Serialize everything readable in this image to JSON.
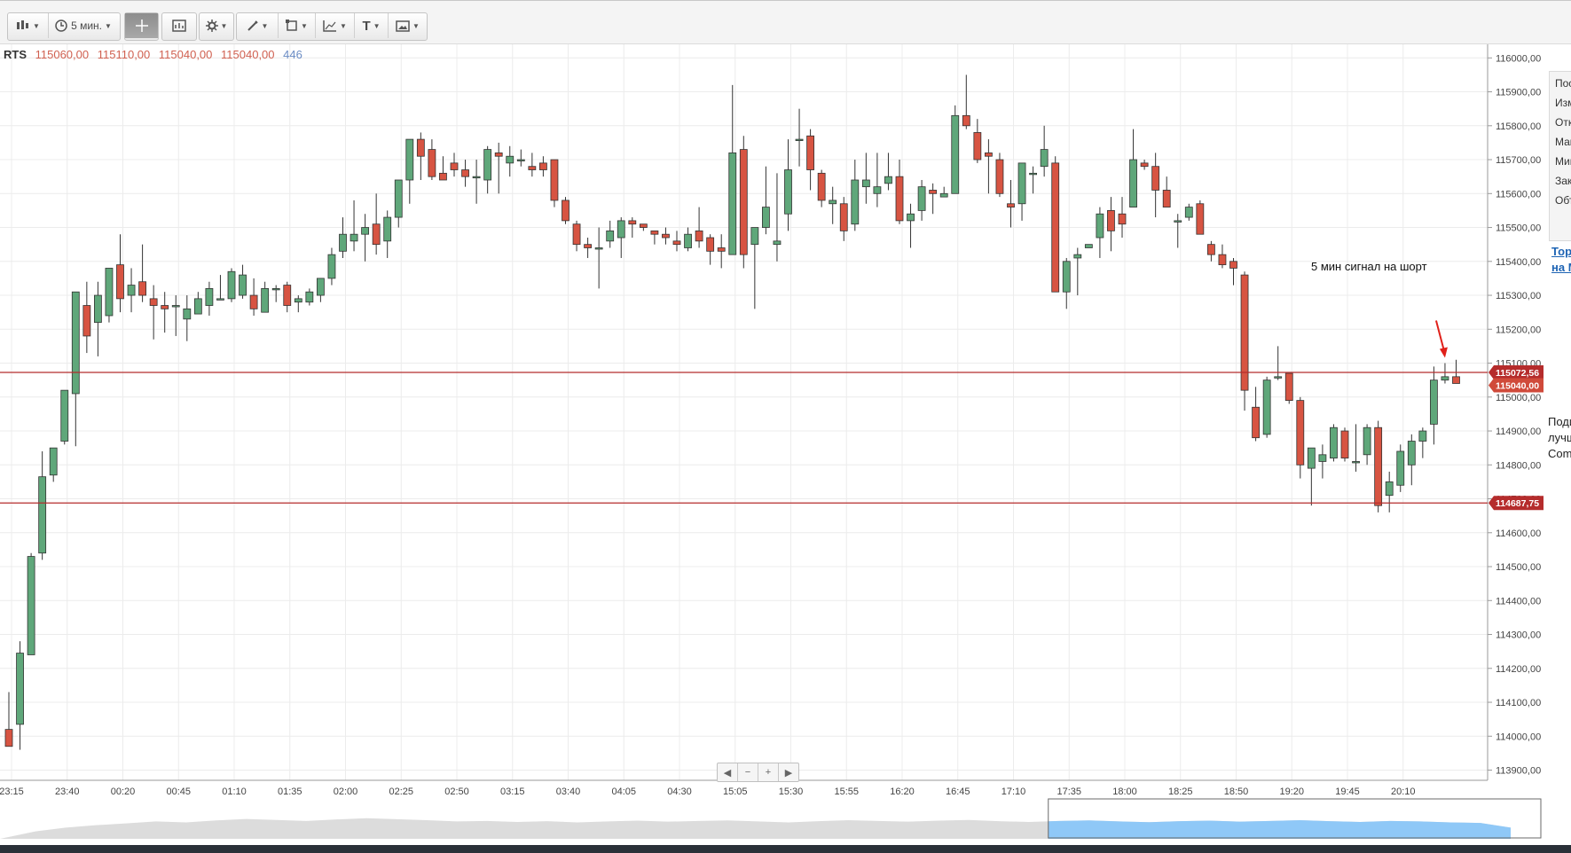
{
  "toolbar": {
    "chart_type_icon": "candlestick-icon",
    "timeframe_label": "5 мин.",
    "crosshair_icon": "crosshair-icon",
    "indicators_icon": "indicator-icon",
    "settings_icon": "gear-icon",
    "draw_icon": "pencil-icon",
    "shapes_icon": "shape-icon",
    "tools_icon": "chart-tools-icon",
    "text_label": "T",
    "image_icon": "image-icon"
  },
  "symbol": {
    "name": "RTS",
    "open": "115060,00",
    "high": "115110,00",
    "low": "115040,00",
    "close": "115040,00",
    "volume": "446"
  },
  "annotation": "5 мин сигнал на шорт",
  "right_panel": {
    "items": [
      "Посл",
      "Изме",
      "Откр",
      "Макс",
      "Мин",
      "Закр",
      "Объ"
    ],
    "link_lines": [
      "Торг",
      "на М"
    ],
    "promo_lines": [
      "Поди",
      "лучш",
      "Com"
    ]
  },
  "navigator_controls": [
    "◀",
    "−",
    "+",
    "▶"
  ],
  "colors": {
    "bull": "#5fa77a",
    "bear": "#d75442",
    "hline": "#b52c2c",
    "grid": "#ececec",
    "navigator_fill": "#8fc8f7",
    "arrow": "#e0201a"
  },
  "chart_data": {
    "type": "candlestick",
    "symbol": "RTS",
    "timeframe": "5 мин.",
    "y_range": [
      113870,
      116040
    ],
    "y_ticks": [
      113900,
      114000,
      114100,
      114200,
      114300,
      114400,
      114500,
      114600,
      114700,
      114800,
      114900,
      115000,
      115100,
      115200,
      115300,
      115400,
      115500,
      115600,
      115700,
      115800,
      115900,
      116000
    ],
    "y_tick_labels": [
      "113900,00",
      "114000,00",
      "114100,00",
      "114200,00",
      "114300,00",
      "114400,00",
      "114500,00",
      "114600,00",
      "114700,00",
      "114800,00",
      "114900,00",
      "115000,00",
      "115100,00",
      "115200,00",
      "115300,00",
      "115400,00",
      "115500,00",
      "115600,00",
      "115700,00",
      "115800,00",
      "115900,00",
      "116000,00"
    ],
    "x_tick_labels": [
      "23:15",
      "23:40",
      "00:20",
      "00:45",
      "01:10",
      "01:35",
      "02:00",
      "02:25",
      "02:50",
      "03:15",
      "03:40",
      "04:05",
      "04:30",
      "15:05",
      "15:30",
      "15:55",
      "16:20",
      "16:45",
      "17:10",
      "17:35",
      "18:00",
      "18:25",
      "18:50",
      "19:20",
      "19:45",
      "20:10"
    ],
    "x_tick_index": [
      0,
      5,
      10,
      15,
      20,
      25,
      30,
      35,
      40,
      45,
      50,
      55,
      60,
      65,
      70,
      75,
      80,
      85,
      90,
      95,
      100,
      105,
      110,
      115,
      120,
      125
    ],
    "candles": [
      [
        114020,
        114130,
        113975,
        113970
      ],
      [
        114035,
        114280,
        113960,
        114245
      ],
      [
        114240,
        114540,
        114240,
        114530
      ],
      [
        114540,
        114840,
        114520,
        114765
      ],
      [
        114770,
        114850,
        114750,
        114850
      ],
      [
        114870,
        115020,
        114860,
        115020
      ],
      [
        115010,
        115310,
        114855,
        115310
      ],
      [
        115270,
        115340,
        115130,
        115180
      ],
      [
        115220,
        115340,
        115120,
        115300
      ],
      [
        115240,
        115380,
        115220,
        115380
      ],
      [
        115390,
        115480,
        115250,
        115290
      ],
      [
        115300,
        115380,
        115250,
        115330
      ],
      [
        115340,
        115450,
        115280,
        115300
      ],
      [
        115290,
        115330,
        115170,
        115270
      ],
      [
        115270,
        115310,
        115190,
        115260
      ],
      [
        115270,
        115300,
        115180,
        115270
      ],
      [
        115230,
        115300,
        115165,
        115260
      ],
      [
        115245,
        115310,
        115250,
        115290
      ],
      [
        115270,
        115340,
        115240,
        115320
      ],
      [
        115290,
        115360,
        115290,
        115290
      ],
      [
        115290,
        115380,
        115280,
        115370
      ],
      [
        115300,
        115390,
        115290,
        115360
      ],
      [
        115300,
        115350,
        115240,
        115260
      ],
      [
        115250,
        115340,
        115250,
        115320
      ],
      [
        115320,
        115330,
        115280,
        115320
      ],
      [
        115330,
        115340,
        115250,
        115270
      ],
      [
        115280,
        115300,
        115250,
        115290
      ],
      [
        115280,
        115320,
        115270,
        115310
      ],
      [
        115300,
        115350,
        115280,
        115350
      ],
      [
        115350,
        115440,
        115330,
        115420
      ],
      [
        115430,
        115530,
        115410,
        115480
      ],
      [
        115460,
        115580,
        115430,
        115480
      ],
      [
        115480,
        115540,
        115400,
        115500
      ],
      [
        115510,
        115600,
        115420,
        115450
      ],
      [
        115460,
        115550,
        115410,
        115530
      ],
      [
        115530,
        115560,
        115500,
        115640
      ],
      [
        115640,
        115680,
        115570,
        115760
      ],
      [
        115760,
        115780,
        115640,
        115710
      ],
      [
        115730,
        115760,
        115640,
        115650
      ],
      [
        115660,
        115710,
        115640,
        115640
      ],
      [
        115690,
        115720,
        115650,
        115670
      ],
      [
        115670,
        115700,
        115620,
        115650
      ],
      [
        115650,
        115700,
        115570,
        115650
      ],
      [
        115640,
        115740,
        115600,
        115730
      ],
      [
        115720,
        115750,
        115600,
        115710
      ],
      [
        115690,
        115740,
        115650,
        115710
      ],
      [
        115700,
        115730,
        115680,
        115700
      ],
      [
        115680,
        115720,
        115650,
        115670
      ],
      [
        115690,
        115710,
        115650,
        115670
      ],
      [
        115700,
        115700,
        115560,
        115580
      ],
      [
        115580,
        115590,
        115510,
        115520
      ],
      [
        115510,
        115520,
        115430,
        115450
      ],
      [
        115450,
        115470,
        115410,
        115440
      ],
      [
        115440,
        115500,
        115320,
        115440
      ],
      [
        115460,
        115520,
        115440,
        115490
      ],
      [
        115470,
        115530,
        115410,
        115520
      ],
      [
        115520,
        115530,
        115470,
        115510
      ],
      [
        115510,
        115510,
        115490,
        115500
      ],
      [
        115490,
        115490,
        115450,
        115480
      ],
      [
        115480,
        115500,
        115450,
        115470
      ],
      [
        115460,
        115490,
        115430,
        115450
      ],
      [
        115440,
        115500,
        115430,
        115480
      ],
      [
        115490,
        115560,
        115440,
        115460
      ],
      [
        115470,
        115480,
        115390,
        115430
      ],
      [
        115440,
        115480,
        115380,
        115430
      ],
      [
        115420,
        115920,
        115420,
        115720
      ],
      [
        115730,
        115770,
        115380,
        115420
      ],
      [
        115450,
        115500,
        115260,
        115500
      ],
      [
        115500,
        115680,
        115480,
        115560
      ],
      [
        115450,
        115660,
        115400,
        115460
      ],
      [
        115540,
        115760,
        115490,
        115670
      ],
      [
        115760,
        115850,
        115680,
        115760
      ],
      [
        115770,
        115790,
        115610,
        115670
      ],
      [
        115660,
        115670,
        115560,
        115580
      ],
      [
        115570,
        115620,
        115510,
        115580
      ],
      [
        115570,
        115590,
        115460,
        115490
      ],
      [
        115510,
        115700,
        115490,
        115640
      ],
      [
        115620,
        115720,
        115570,
        115640
      ],
      [
        115600,
        115720,
        115560,
        115620
      ],
      [
        115630,
        115720,
        115610,
        115650
      ],
      [
        115650,
        115700,
        115510,
        115520
      ],
      [
        115520,
        115570,
        115440,
        115540
      ],
      [
        115550,
        115640,
        115520,
        115620
      ],
      [
        115610,
        115630,
        115540,
        115600
      ],
      [
        115590,
        115620,
        115590,
        115600
      ],
      [
        115600,
        115860,
        115600,
        115830
      ],
      [
        115830,
        115950,
        115790,
        115800
      ],
      [
        115780,
        115820,
        115690,
        115700
      ],
      [
        115720,
        115760,
        115600,
        115710
      ],
      [
        115700,
        115720,
        115590,
        115600
      ],
      [
        115570,
        115640,
        115500,
        115560
      ],
      [
        115570,
        115690,
        115520,
        115690
      ],
      [
        115660,
        115680,
        115600,
        115660
      ],
      [
        115680,
        115800,
        115650,
        115730
      ],
      [
        115690,
        115710,
        115320,
        115310
      ],
      [
        115310,
        115410,
        115260,
        115400
      ],
      [
        115410,
        115440,
        115300,
        115420
      ],
      [
        115440,
        115450,
        115440,
        115450
      ],
      [
        115470,
        115560,
        115410,
        115540
      ],
      [
        115550,
        115590,
        115430,
        115490
      ],
      [
        115540,
        115590,
        115470,
        115510
      ],
      [
        115560,
        115790,
        115560,
        115700
      ],
      [
        115690,
        115700,
        115670,
        115680
      ],
      [
        115680,
        115720,
        115530,
        115610
      ],
      [
        115610,
        115650,
        115570,
        115560
      ],
      [
        115520,
        115540,
        115440,
        115520
      ],
      [
        115530,
        115570,
        115520,
        115560
      ],
      [
        115570,
        115580,
        115480,
        115480
      ],
      [
        115450,
        115460,
        115400,
        115420
      ],
      [
        115420,
        115450,
        115380,
        115390
      ],
      [
        115400,
        115410,
        115330,
        115380
      ],
      [
        115360,
        115370,
        114960,
        115020
      ],
      [
        114970,
        115030,
        114870,
        114880
      ],
      [
        114890,
        115060,
        114880,
        115050
      ],
      [
        115060,
        115150,
        115050,
        115060
      ],
      [
        115070,
        115070,
        114980,
        114990
      ],
      [
        114990,
        115000,
        114760,
        114800
      ],
      [
        114790,
        114830,
        114680,
        114850
      ],
      [
        114810,
        114860,
        114760,
        114830
      ],
      [
        114820,
        114920,
        114810,
        114910
      ],
      [
        114900,
        114910,
        114810,
        114820
      ],
      [
        114810,
        114920,
        114780,
        114810
      ],
      [
        114830,
        114920,
        114800,
        114910
      ],
      [
        114910,
        114930,
        114660,
        114680
      ],
      [
        114710,
        114780,
        114660,
        114750
      ],
      [
        114740,
        114860,
        114720,
        114840
      ],
      [
        114800,
        114890,
        114740,
        114870
      ],
      [
        114870,
        114910,
        114820,
        114900
      ],
      [
        114920,
        115090,
        114860,
        115050
      ],
      [
        115050,
        115100,
        115040,
        115060
      ],
      [
        115060,
        115110,
        115040,
        115040
      ]
    ],
    "hlines": [
      {
        "value": 115072.56,
        "label": "115072,56"
      },
      {
        "value": 114687.75,
        "label": "114687,75"
      }
    ],
    "last_price_label": "115040,00",
    "navigator": {
      "profile": [
        0.3,
        0.45,
        0.55,
        0.62,
        0.7,
        0.66,
        0.74,
        0.8,
        0.76,
        0.72,
        0.78,
        0.83,
        0.79,
        0.75,
        0.7,
        0.72,
        0.68,
        0.71,
        0.66,
        0.7,
        0.73,
        0.69,
        0.72,
        0.74,
        0.7,
        0.66,
        0.71,
        0.75,
        0.72,
        0.69,
        0.73,
        0.76,
        0.71,
        0.68,
        0.72,
        0.74,
        0.7,
        0.67,
        0.71,
        0.73,
        0.69,
        0.72,
        0.75,
        0.71,
        0.68,
        0.72,
        0.7,
        0.66,
        0.64,
        0.45
      ],
      "window_start_fraction": 0.678,
      "window_end_fraction": 1.0
    }
  }
}
